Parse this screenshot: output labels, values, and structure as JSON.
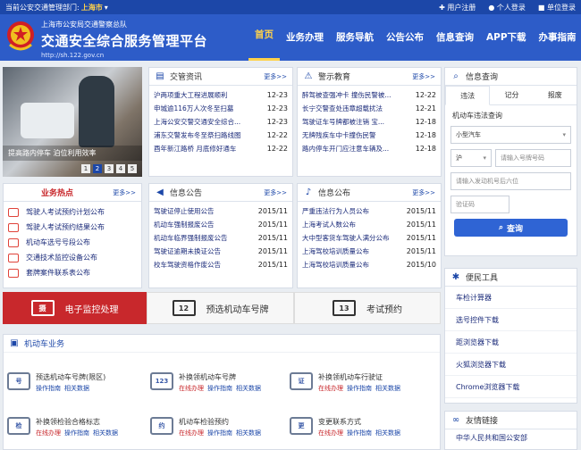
{
  "topbar": {
    "prefix": "当前公安交通管理部门:",
    "city": "上海市",
    "register": "用户注册",
    "personal": "个人登录",
    "unit": "单位登录"
  },
  "brand": {
    "sub": "上海市公安局交通警察总队",
    "title": "交通安全综合服务管理平台",
    "url": "http://sh.122.gov.cn"
  },
  "nav": [
    "首页",
    "业务办理",
    "服务导航",
    "公告公布",
    "信息查询",
    "APP下载",
    "办事指南"
  ],
  "slider": {
    "caption": "提高路内停车 泊位利用效率",
    "pages": [
      "1",
      "2",
      "3",
      "4",
      "5"
    ],
    "active": 1
  },
  "more": "更多>>",
  "jgzx": {
    "title": "交管资讯",
    "items": [
      [
        "沪两项重大工程进展顺利",
        "12-23"
      ],
      [
        "申城逾116万人次冬至扫墓",
        "12-23"
      ],
      [
        "上海公安交警交通安全综合...",
        "12-23"
      ],
      [
        "浦东交警发布冬至祭扫路线图",
        "12-22"
      ],
      [
        "酉年新江路桥 月底修好通车",
        "12-22"
      ]
    ]
  },
  "jsjy": {
    "title": "警示教育",
    "items": [
      [
        "醉驾被查强冲卡 撞伤民警被...",
        "12-22"
      ],
      [
        "长宁交警查处违章超载扰法",
        "12-21"
      ],
      [
        "驾驶证车号牌都被注销 宝...",
        "12-18"
      ],
      [
        "无牌残疾车中卡撞伤民警",
        "12-18"
      ],
      [
        "路内停车开门应注意车辆及...",
        "12-18"
      ]
    ]
  },
  "hot": {
    "title": "业务热点",
    "items": [
      "驾驶人考试预约计划公布",
      "驾驶人考试预约结果公布",
      "机动车选号号段公布",
      "交通技术监控设备公布",
      "套牌案件联系表公布"
    ]
  },
  "xxgg": {
    "title": "信息公告",
    "items": [
      [
        "驾驶证停止使用公告",
        "2015/11"
      ],
      [
        "机动车强制报废公告",
        "2015/11"
      ],
      [
        "机动车临界强制报废公告",
        "2015/11"
      ],
      [
        "驾驶证逾期未换证公告",
        "2015/11"
      ],
      [
        "校车驾驶资格作废公告",
        "2015/11"
      ]
    ]
  },
  "xxgb": {
    "title": "信息公布",
    "items": [
      [
        "严重违法行为人员公布",
        "2015/11"
      ],
      [
        "上海考试人数公布",
        "2015/11"
      ],
      [
        "大中型客货车驾驶人满分公布",
        "2015/11"
      ],
      [
        "上海驾校培训质量公布",
        "2015/11"
      ],
      [
        "上海驾校培训质量公布",
        "2015/10"
      ]
    ]
  },
  "bands": [
    {
      "icon": "摄",
      "label": "电子监控处理"
    },
    {
      "icon": "12",
      "label": "预选机动车号牌"
    },
    {
      "icon": "13",
      "label": "考试预约"
    }
  ],
  "biz": {
    "title": "机动车业务",
    "online": "在线办理",
    "guide": "操作指南",
    "related": "相关数据",
    "items": [
      {
        "icon": "号",
        "name": "预选机动车号牌(限区)"
      },
      {
        "icon": "123",
        "name": "补换领机动车号牌"
      },
      {
        "icon": "证",
        "name": "补换领机动车行驶证"
      },
      {
        "icon": "检",
        "name": "补换领检验合格标志"
      },
      {
        "icon": "约",
        "name": "机动车检验预约"
      },
      {
        "icon": "更",
        "name": "变更联系方式"
      }
    ]
  },
  "query": {
    "title": "信息查询",
    "tabs": [
      "违法",
      "记分",
      "报废"
    ],
    "subtitle": "机动车违法查询",
    "type": "小型汽车",
    "prefix": "沪",
    "plate_ph": "请输入号牌号码",
    "engine_ph": "请输入发动机号后六位",
    "code_ph": "验证码",
    "btn": "查询"
  },
  "tools": {
    "title": "便民工具",
    "items": [
      "车检计算器",
      "选号控件下载",
      "距浏览器下载",
      "火狐浏览器下载",
      "Chrome浏览器下载"
    ]
  },
  "links": {
    "title": "友情链接",
    "first": "中华人民共和国公安部"
  }
}
